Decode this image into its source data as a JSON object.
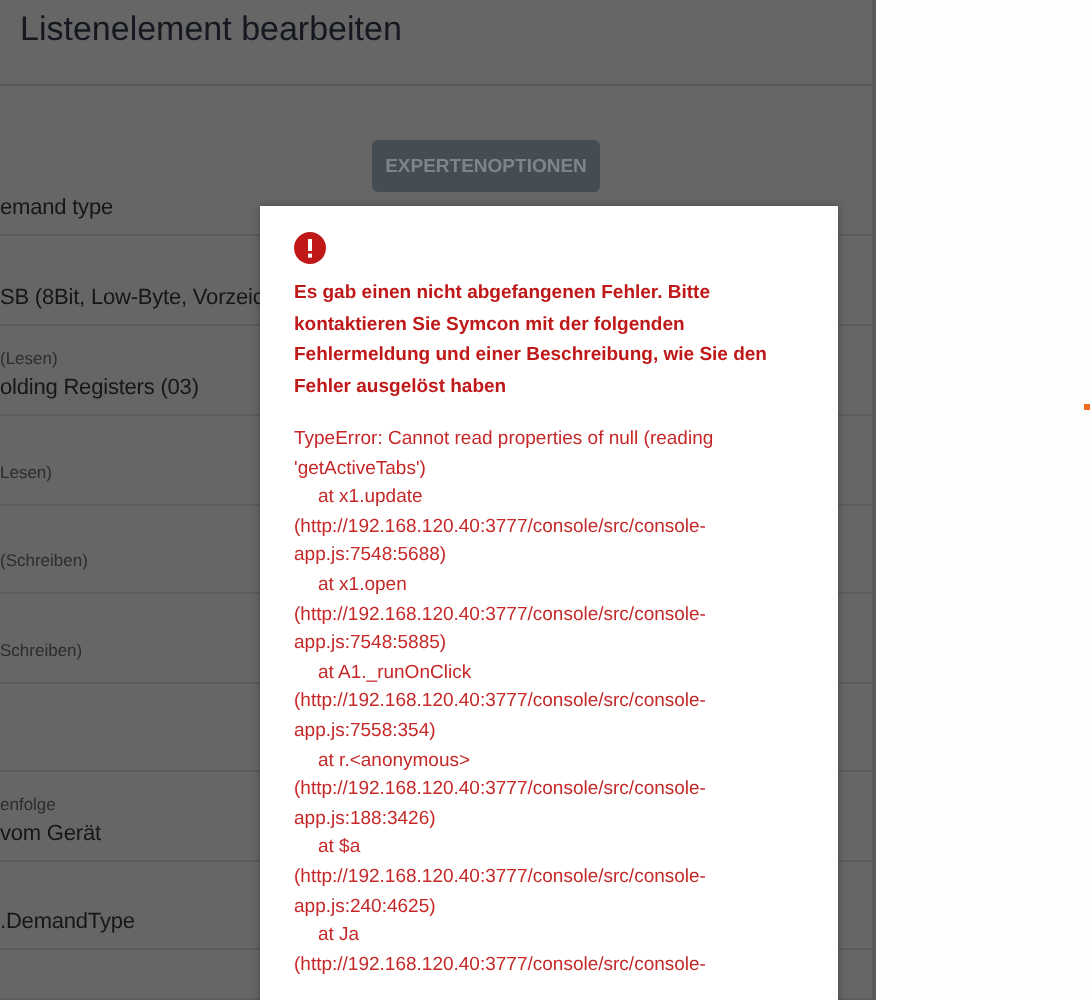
{
  "dialog": {
    "title": "Listenelement bearbeiten",
    "expert_button": "EXPERTENOPTIONEN",
    "rows": [
      {
        "label": "",
        "value": "emand type"
      },
      {
        "label": "",
        "value": "SB (8Bit, Low-Byte, Vorzeic"
      },
      {
        "label": "(Lesen)",
        "value": "olding Registers (03)"
      },
      {
        "label": "Lesen)",
        "value": ""
      },
      {
        "label": "(Schreiben)",
        "value": ""
      },
      {
        "label": "Schreiben)",
        "value": ""
      },
      {
        "label": "",
        "value": ""
      },
      {
        "label": "enfolge",
        "value": "vom Gerät"
      },
      {
        "label": "",
        "value": ".DemandType"
      },
      {
        "label": "",
        "value": ""
      }
    ]
  },
  "error_modal": {
    "message": "Es gab einen nicht abgefangenen Fehler. Bitte kontaktieren Sie Symcon mit der folgenden Fehlermeldung und einer Beschreibung, wie Sie den Fehler ausgelöst haben",
    "error": "TypeError: Cannot read properties of null (reading 'getActiveTabs')",
    "frames": [
      {
        "at": "at x1.update",
        "location": "(http://192.168.120.40:3777/console/src/console-app.js:7548:5688)"
      },
      {
        "at": "at x1.open",
        "location": "(http://192.168.120.40:3777/console/src/console-app.js:7548:5885)"
      },
      {
        "at": "at A1._runOnClick",
        "location": "(http://192.168.120.40:3777/console/src/console-app.js:7558:354)"
      },
      {
        "at": "at r.<anonymous>",
        "location": "(http://192.168.120.40:3777/console/src/console-app.js:188:3426)"
      },
      {
        "at": "at $a",
        "location": "(http://192.168.120.40:3777/console/src/console-app.js:240:4625)"
      },
      {
        "at": "at Ja",
        "location": "(http://192.168.120.40:3777/console/src/console-"
      }
    ]
  }
}
